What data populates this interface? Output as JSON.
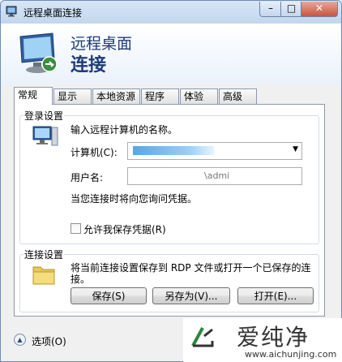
{
  "window": {
    "title": "远程桌面连接",
    "controls": {
      "minimize": "–",
      "maximize": "□",
      "close": "✕"
    }
  },
  "header": {
    "line1": "远程桌面",
    "line2": "连接"
  },
  "tabs": [
    {
      "label": "常规",
      "active": true
    },
    {
      "label": "显示",
      "active": false
    },
    {
      "label": "本地资源",
      "active": false
    },
    {
      "label": "程序",
      "active": false
    },
    {
      "label": "体验",
      "active": false
    },
    {
      "label": "高级",
      "active": false
    }
  ],
  "login": {
    "group_label": "登录设置",
    "instruction": "输入远程计算机的名称。",
    "computer_label": "计算机(C):",
    "computer_value": "",
    "username_label": "用户名:",
    "username_value": "\\admi",
    "credential_note": "当您连接时将向您询问凭据。",
    "allow_save_label": "允许我保存凭据(R)",
    "allow_save_checked": false
  },
  "connection": {
    "group_label": "连接设置",
    "description_line1": "将当前连接设置保存到 RDP 文件或打开一个已保存的连",
    "description_line2": "接。",
    "save_label": "保存(S)",
    "save_as_label": "另存为(V)...",
    "open_label": "打开(E)..."
  },
  "footer": {
    "options_label": "选项(O)"
  },
  "watermark": {
    "brand": "爱纯净",
    "url": "www.aichunjing.com"
  },
  "colors": {
    "header_text": "#1e3c78",
    "selection_blue": "#5aa5e5"
  }
}
